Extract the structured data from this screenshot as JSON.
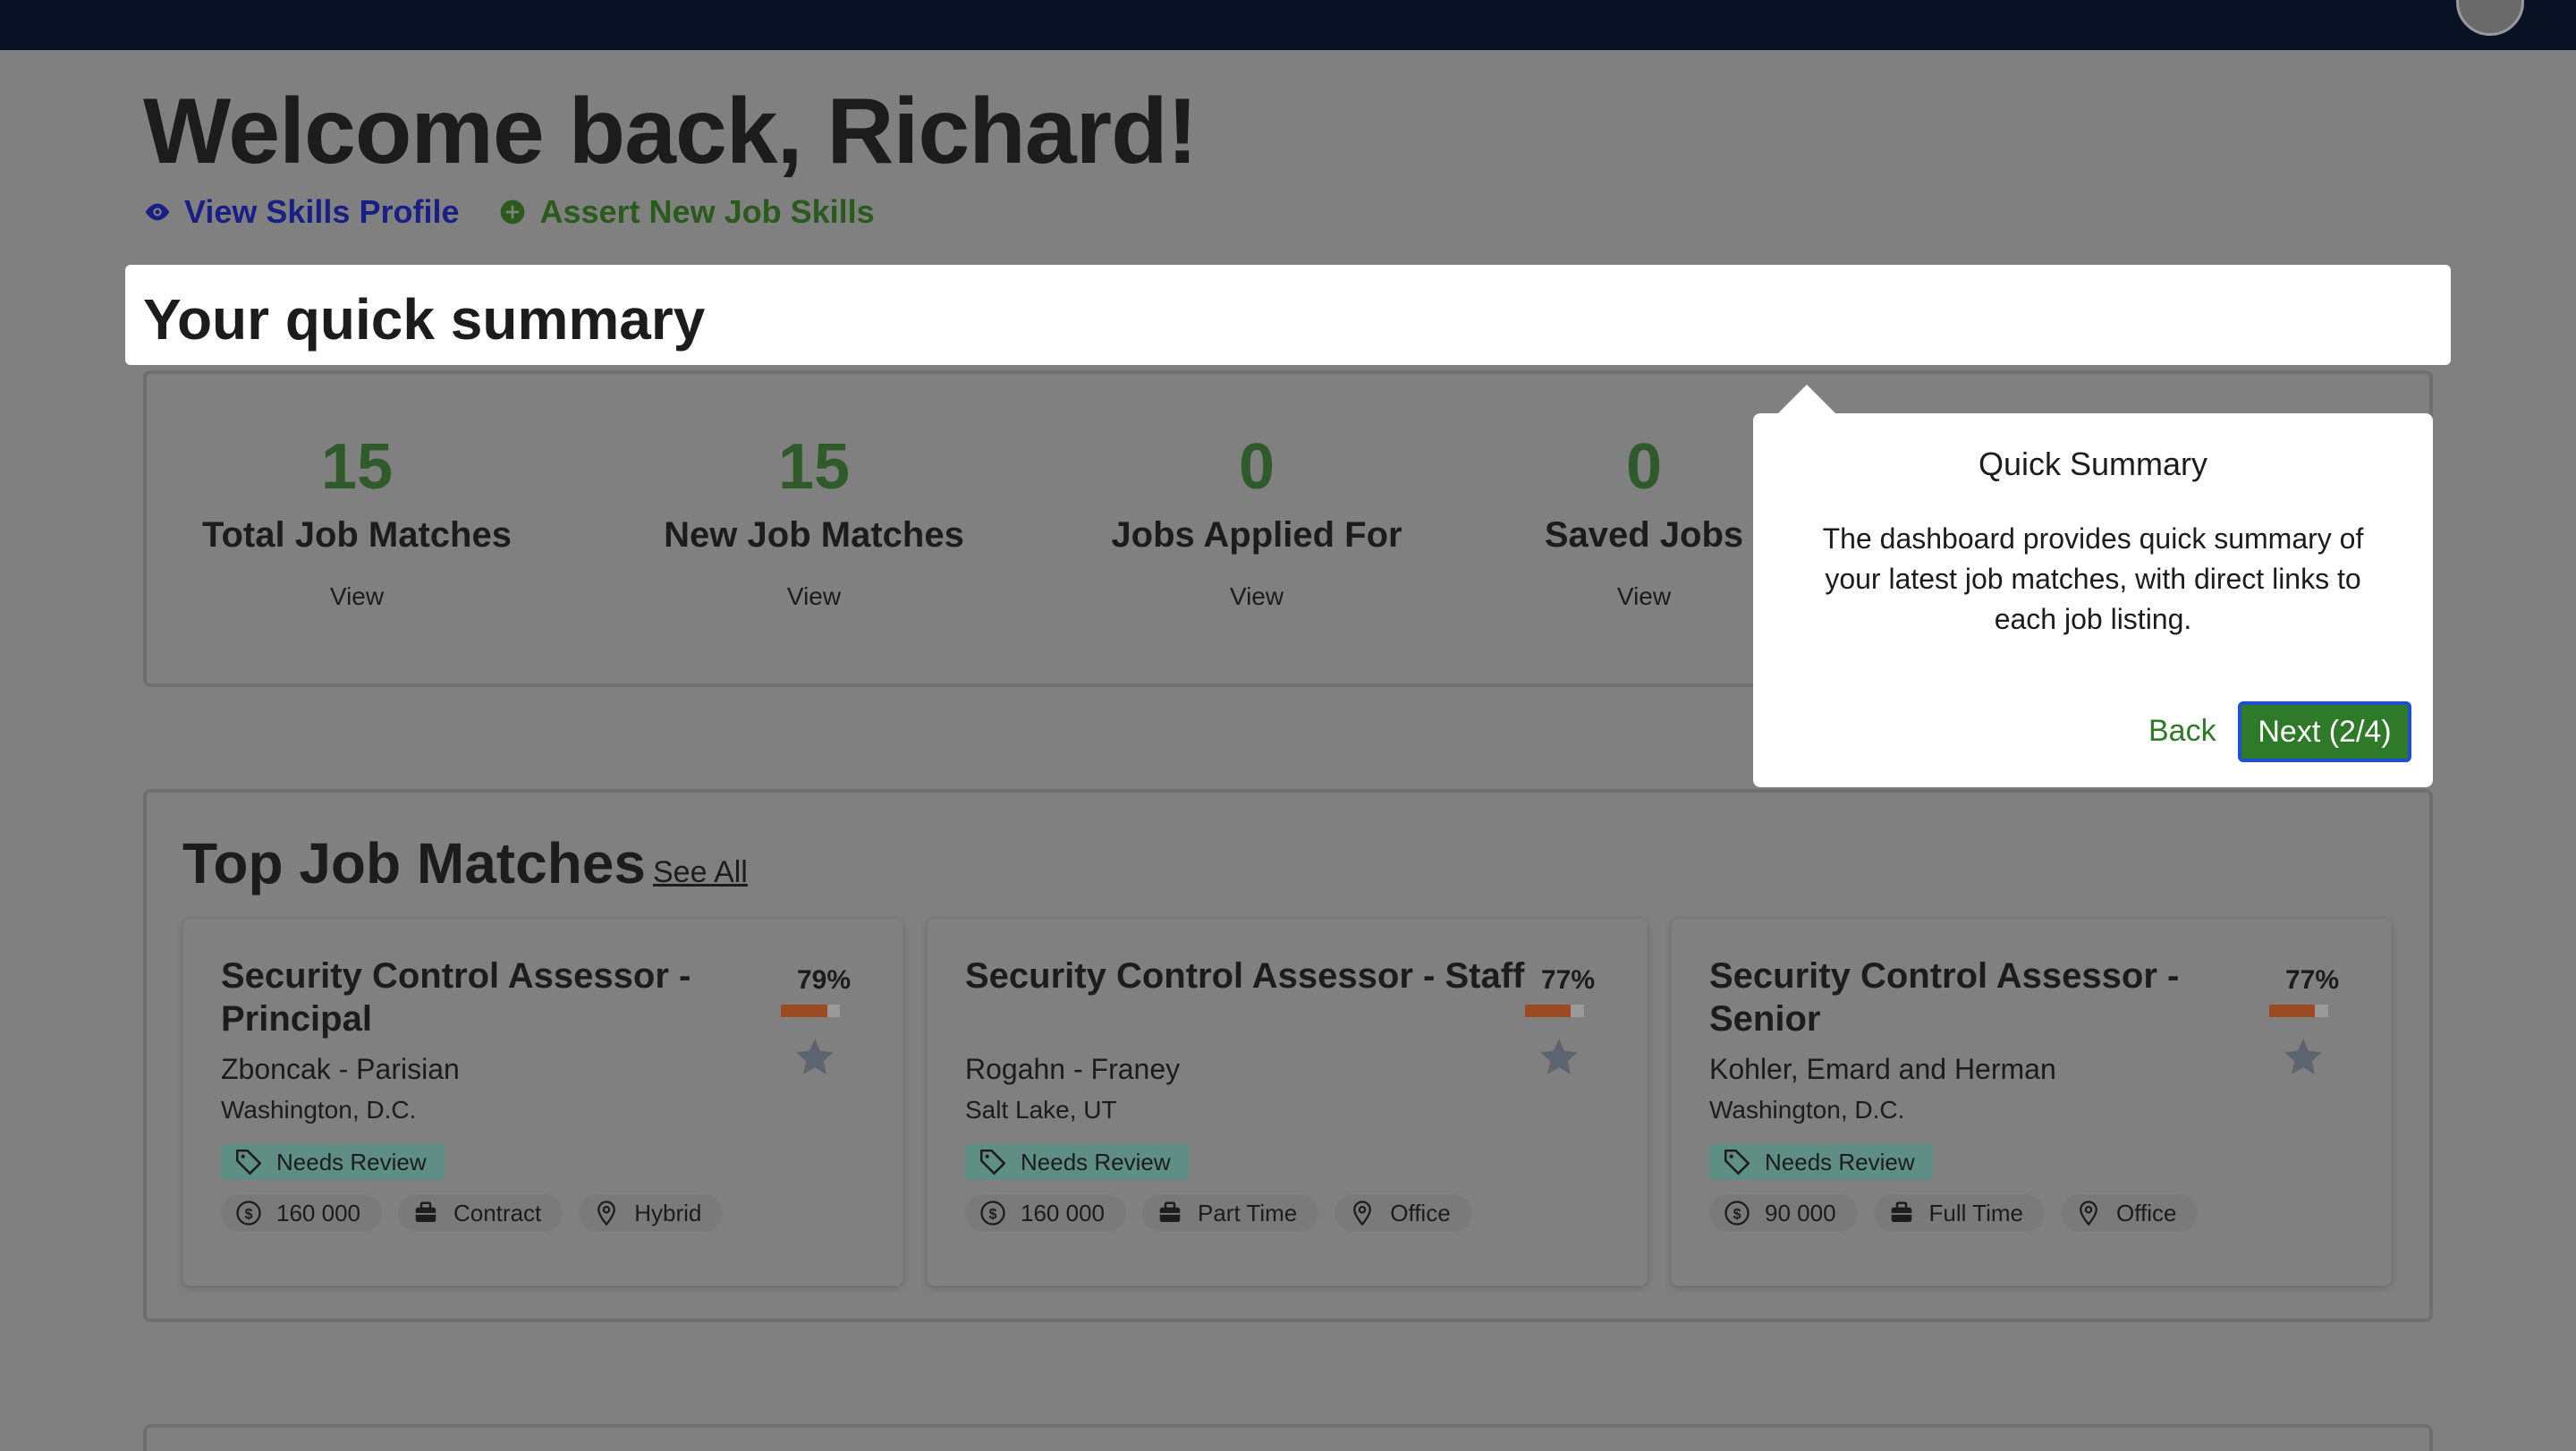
{
  "welcome": "Welcome back, Richard!",
  "links": {
    "view_skills": "View Skills Profile",
    "assert_skills": "Assert New Job Skills"
  },
  "summary": {
    "title": "Your quick summary",
    "stats": [
      {
        "value": "15",
        "label": "Total Job Matches",
        "action": "View"
      },
      {
        "value": "15",
        "label": "New Job Matches",
        "action": "View"
      },
      {
        "value": "0",
        "label": "Jobs Applied For",
        "action": "View"
      },
      {
        "value": "0",
        "label": "Saved Jobs",
        "action": "View"
      }
    ]
  },
  "tour": {
    "title": "Quick Summary",
    "body": "The dashboard provides quick summary of your latest job matches, with direct links to each job listing.",
    "back": "Back",
    "next": "Next (2/4)"
  },
  "matches": {
    "title": "Top Job Matches",
    "see_all": "See All",
    "cards": [
      {
        "title": "Security Control Assessor - Principal",
        "company": "Zboncak - Parisian",
        "location": "Washington, D.C.",
        "match": "79%",
        "match_fraction": 0.79,
        "status": "Needs Review",
        "salary": "160 000",
        "type": "Contract",
        "workplace": "Hybrid"
      },
      {
        "title": "Security Control Assessor - Staff",
        "company": "Rogahn - Franey",
        "location": "Salt Lake, UT",
        "match": "77%",
        "match_fraction": 0.77,
        "status": "Needs Review",
        "salary": "160 000",
        "type": "Part Time",
        "workplace": "Office"
      },
      {
        "title": "Security Control Assessor - Senior",
        "company": "Kohler, Emard and Herman",
        "location": "Washington, D.C.",
        "match": "77%",
        "match_fraction": 0.77,
        "status": "Needs Review",
        "salary": "90 000",
        "type": "Full Time",
        "workplace": "Office"
      }
    ]
  },
  "colors": {
    "topbar": "#0a1226",
    "accent_green": "#2e7a28",
    "link_blue": "#1a1f86",
    "match_bar": "#9c4a20"
  }
}
